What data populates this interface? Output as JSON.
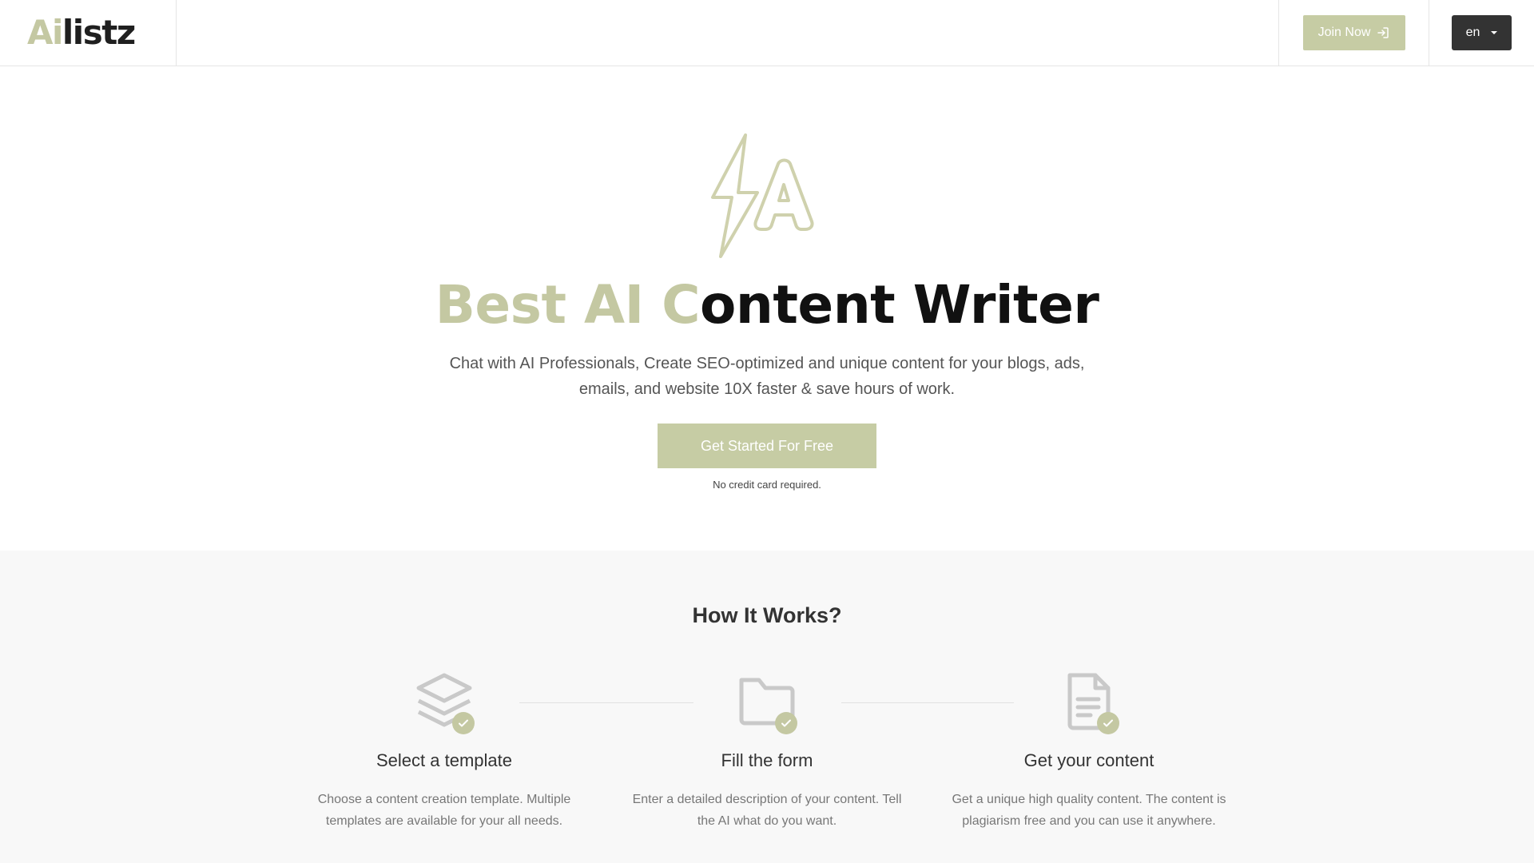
{
  "header": {
    "logo_ai": "Ai",
    "logo_rest": "listz",
    "join_label": "Join Now",
    "lang_label": "en"
  },
  "hero": {
    "title_highlight": "Best AI C",
    "title_rest": "ontent Writer",
    "subtitle": "Chat with AI Professionals, Create SEO-optimized and unique content for your blogs, ads, emails, and website 10X faster & save hours of work.",
    "cta_label": "Get Started For Free",
    "cta_note": "No credit card required."
  },
  "how": {
    "title": "How It Works?",
    "steps": [
      {
        "icon": "layers-icon",
        "title": "Select a template",
        "desc": "Choose a content creation template. Multiple templates are available for your all needs."
      },
      {
        "icon": "folder-icon",
        "title": "Fill the form",
        "desc": "Enter a detailed description of your content. Tell the AI what do you want."
      },
      {
        "icon": "document-icon",
        "title": "Get your content",
        "desc": "Get a unique high quality content. The content is plagiarism free and you can use it anywhere."
      }
    ]
  },
  "colors": {
    "accent": "#c6cca4",
    "dark_button": "#333333",
    "section_bg": "#f8f8f8"
  }
}
